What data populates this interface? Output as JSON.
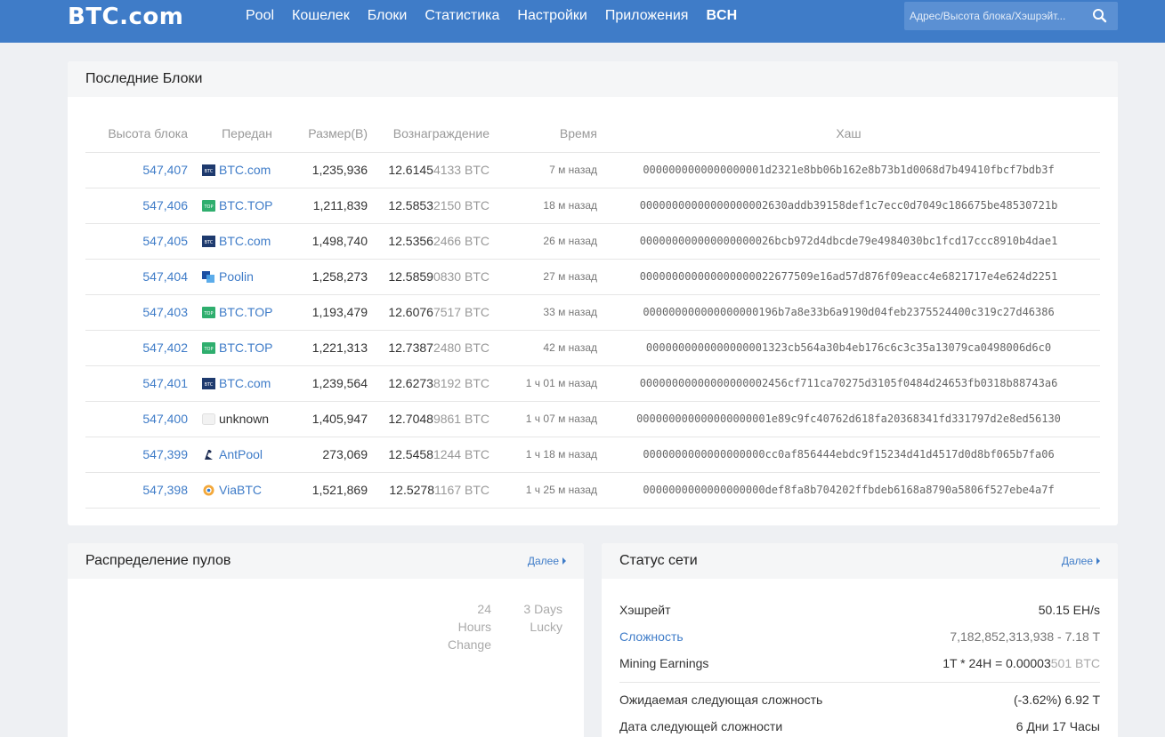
{
  "header": {
    "logo": "BTC.com",
    "nav": [
      {
        "label": "Pool"
      },
      {
        "label": "Кошелек"
      },
      {
        "label": "Блоки"
      },
      {
        "label": "Статистика"
      },
      {
        "label": "Настройки"
      },
      {
        "label": "Приложения"
      },
      {
        "label": "BCH"
      }
    ],
    "search_placeholder": "Адрес/Высота блока/Хэшрэйт..."
  },
  "latest_blocks": {
    "title": "Последние Блоки",
    "columns": [
      "Высота блока",
      "Передан",
      "Размер(B)",
      "Вознаграждение",
      "Время",
      "Хаш"
    ],
    "rows": [
      {
        "height": "547,407",
        "pool": "BTC.com",
        "pool_icon": "btccom-icon",
        "size": "1,235,936",
        "reward_main": "12.6145",
        "reward_rest": "4133 BTC",
        "time": "7 м назад",
        "hash": "0000000000000000001d2321e8bb06b162e8b73b1d0068d7b49410fbcf7bdb3f"
      },
      {
        "height": "547,406",
        "pool": "BTC.TOP",
        "pool_icon": "btctop-icon",
        "size": "1,211,839",
        "reward_main": "12.5853",
        "reward_rest": "2150 BTC",
        "time": "18 м назад",
        "hash": "00000000000000000002630addb39158def1c7ecc0d7049c186675be48530721b"
      },
      {
        "height": "547,405",
        "pool": "BTC.com",
        "pool_icon": "btccom-icon",
        "size": "1,498,740",
        "reward_main": "12.5356",
        "reward_rest": "2466 BTC",
        "time": "26 м назад",
        "hash": "000000000000000000026bcb972d4dbcde79e4984030bc1fcd17ccc8910b4dae1"
      },
      {
        "height": "547,404",
        "pool": "Poolin",
        "pool_icon": "poolin-icon",
        "size": "1,258,273",
        "reward_main": "12.5859",
        "reward_rest": "0830 BTC",
        "time": "27 м назад",
        "hash": "000000000000000000022677509e16ad57d876f09eacc4e6821717e4e624d2251"
      },
      {
        "height": "547,403",
        "pool": "BTC.TOP",
        "pool_icon": "btctop-icon",
        "size": "1,193,479",
        "reward_main": "12.6076",
        "reward_rest": "7517 BTC",
        "time": "33 м назад",
        "hash": "000000000000000000196b7a8e33b6a9190d04feb2375524400c319c27d46386"
      },
      {
        "height": "547,402",
        "pool": "BTC.TOP",
        "pool_icon": "btctop-icon",
        "size": "1,221,313",
        "reward_main": "12.7387",
        "reward_rest": "2480 BTC",
        "time": "42 м назад",
        "hash": "0000000000000000001323cb564a30b4eb176c6c3c35a13079ca0498006d6c0"
      },
      {
        "height": "547,401",
        "pool": "BTC.com",
        "pool_icon": "btccom-icon",
        "size": "1,239,564",
        "reward_main": "12.6273",
        "reward_rest": "8192 BTC",
        "time": "1 ч 01 м назад",
        "hash": "00000000000000000002456cf711ca70275d3105f0484d24653fb0318b88743a6"
      },
      {
        "height": "547,400",
        "pool": "unknown",
        "pool_icon": "unknown-icon",
        "size": "1,405,947",
        "reward_main": "12.7048",
        "reward_rest": "9861 BTC",
        "time": "1 ч 07 м назад",
        "hash": "000000000000000000001e89c9fc40762d618fa20368341fd331797d2e8ed56130"
      },
      {
        "height": "547,399",
        "pool": "AntPool",
        "pool_icon": "antpool-icon",
        "size": "273,069",
        "reward_main": "12.5458",
        "reward_rest": "1244 BTC",
        "time": "1 ч 18 м назад",
        "hash": "0000000000000000000cc0af856444ebdc9f15234d41d4517d0d8bf065b7fa06"
      },
      {
        "height": "547,398",
        "pool": "ViaBTC",
        "pool_icon": "viabtc-icon",
        "size": "1,521,869",
        "reward_main": "12.5278",
        "reward_rest": "1167 BTC",
        "time": "1 ч 25 м назад",
        "hash": "0000000000000000000def8fa8b704202ffbdeb6168a8790a5806f527ebe4a7f"
      }
    ]
  },
  "pool_distribution": {
    "title": "Распределение пулов",
    "more": "Далее",
    "col1": [
      "24 Hours",
      "Change"
    ],
    "col2": [
      "3 Days",
      "Lucky"
    ]
  },
  "network_status": {
    "title": "Статус сети",
    "more": "Далее",
    "hashrate": {
      "label": "Хэшрейт",
      "value": "50.15 EH/s"
    },
    "difficulty": {
      "label": "Сложность",
      "value": "7,182,852,313,938 - 7.18 T"
    },
    "mining_earnings": {
      "label": "Mining Earnings",
      "value_main": "1T * 24H = 0.00003",
      "value_rest": "501 BTC"
    },
    "next_difficulty": {
      "label": "Ожидаемая следующая сложность",
      "value": "(-3.62%) 6.92 T"
    },
    "next_difficulty_date": {
      "label": "Дата следующей сложности",
      "value": "6 Дни 17 Часы"
    }
  },
  "colors": {
    "header": "#3f7cc8",
    "link": "#3f7cc8",
    "background": "#eef0f3"
  }
}
